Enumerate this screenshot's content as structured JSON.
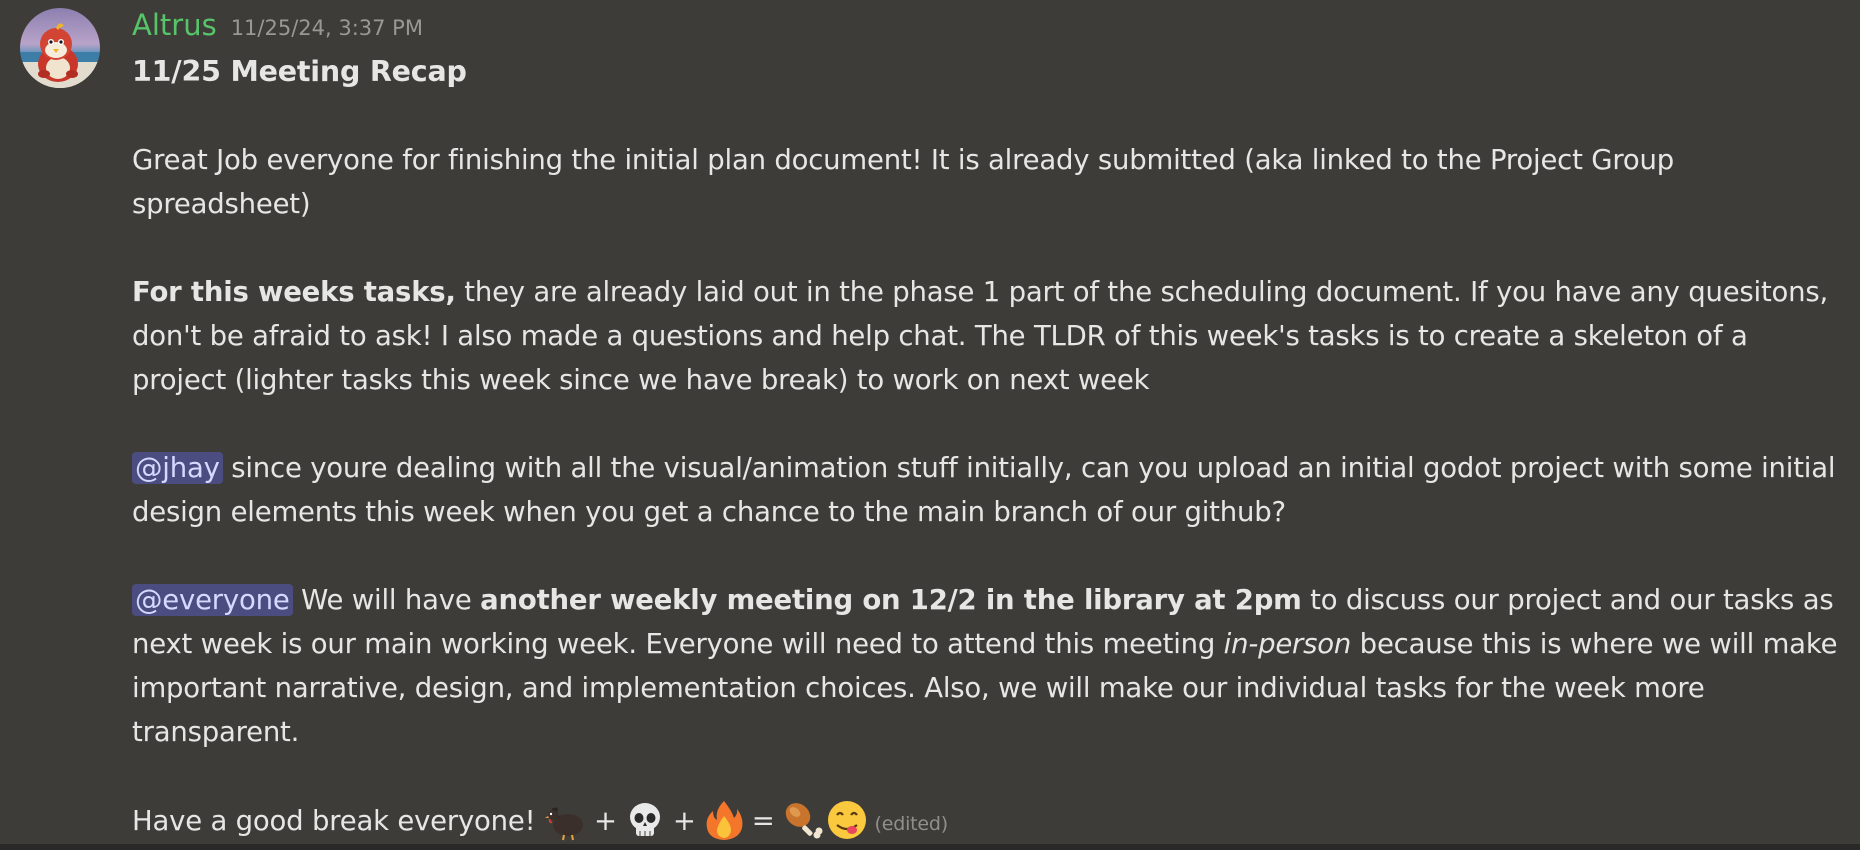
{
  "author": {
    "username": "Altrus",
    "timestamp": "11/25/24, 3:37 PM",
    "avatar_icon": "red-cartoon-character-avatar"
  },
  "message": {
    "title": "11/25 Meeting Recap",
    "p1": "Great Job everyone for finishing the initial plan document! It is already submitted (aka linked to the Project Group spreadsheet)",
    "p2_bold": "For this weeks tasks,",
    "p2_rest": " they are already laid out in the phase 1 part of the scheduling document. If you have any quesitons, don't be afraid to ask! I also made a questions and help chat. The TLDR of this week's tasks is to create a skeleton of a project (lighter tasks this week since we have break) to work on next week",
    "p3_mention": "@jhay",
    "p3_rest": " since youre dealing with all the visual/animation stuff initially, can you upload an initial godot project with some initial design elements this week when you get a chance to the main branch of our github?",
    "p4_mention": "@everyone",
    "p4_text1": " We will have ",
    "p4_bold": "another weekly meeting on 12/2 in the library at 2pm",
    "p4_text2": " to discuss our project and our tasks as next week is our main working week. Everyone will need to attend this meeting ",
    "p4_italic": "in-person",
    "p4_text3": " because this is where we will make important narrative, design, and implementation choices. Also, we will make our individual tasks for the week more transparent.",
    "p5": "Have a good break everyone! ",
    "emoji_equation": {
      "items": [
        "turkey-emoji",
        "skull-emoji",
        "fire-emoji",
        "poultry-leg-emoji",
        "yum-face-emoji"
      ],
      "plus": "+",
      "equals": "="
    },
    "edited_label": "(edited)"
  },
  "colors": {
    "background": "#3e3c38",
    "username": "#57c46a",
    "mention_bg": "#4b4d80",
    "text": "#e6e6e4"
  }
}
